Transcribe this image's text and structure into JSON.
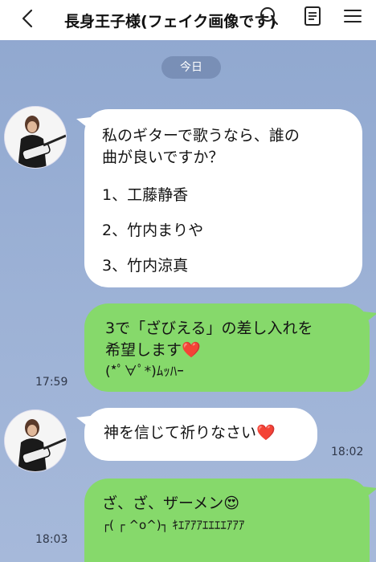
{
  "header": {
    "title": "長身王子様(フェイク画像です)"
  },
  "date_label": "今日",
  "messages": [
    {
      "lines": [
        "私のギターで歌うなら、誰の",
        "曲が良いですか？",
        "1、工藤静香",
        "2、竹内まりや",
        "3、竹内涼真"
      ]
    },
    {
      "lines": [
        "3で「ざびえる」の差し入れを",
        "希望します❤️",
        "(*ﾟ∀ﾟ*)ﾑｯﾊｰ"
      ],
      "time": "17:59"
    },
    {
      "lines": [
        "神を信じて祈りなさい❤️"
      ],
      "time": "18:02"
    },
    {
      "lines": [
        "ざ、ざ、ザーメン😍",
        "┌( ┌ ^o^)┐ ｷｴｱｱｱｴｴｴｴｱｱｱ"
      ],
      "time": "18:03"
    }
  ],
  "colors": {
    "background": "#9db2d6",
    "sent_bubble": "#86d96b",
    "received_bubble": "#ffffff"
  }
}
